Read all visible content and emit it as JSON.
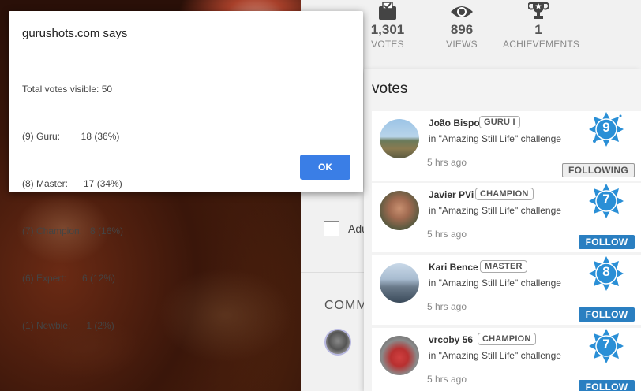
{
  "dialog": {
    "title": "gurushots.com says",
    "lines": [
      "Total votes visible: 50",
      "(9) Guru:        18 (36%)",
      "(8) Master:      17 (34%)",
      "(7) Champion:   8 (16%)",
      "(6) Expert:      6 (12%)",
      "(1) Newbie:      1 (2%)"
    ],
    "ok_label": "OK"
  },
  "stats": {
    "votes": {
      "value": "1,301",
      "label": "VOTES",
      "icon": "ballot-box-icon"
    },
    "views": {
      "value": "896",
      "label": "VIEWS",
      "icon": "eye-icon"
    },
    "achievements": {
      "value": "1",
      "label": "ACHIEVEMENTS",
      "icon": "trophy-icon"
    }
  },
  "page": {
    "adult_label": "Adu",
    "comments_title": "COMM"
  },
  "panel": {
    "title": "votes",
    "items": [
      {
        "name": "João Bispo",
        "rank": "GURU I",
        "challenge": "in \"Amazing Still Life\" challenge",
        "time": "5 hrs ago",
        "level": "9",
        "button": "FOLLOWING"
      },
      {
        "name": "Javier PVi",
        "rank": "CHAMPION",
        "challenge": "in \"Amazing Still Life\" challenge",
        "time": "5 hrs ago",
        "level": "7",
        "button": "FOLLOW"
      },
      {
        "name": "Kari Bence",
        "rank": "MASTER",
        "challenge": "in \"Amazing Still Life\" challenge",
        "time": "5 hrs ago",
        "level": "8",
        "button": "FOLLOW"
      },
      {
        "name": "vrcoby 56",
        "rank": "CHAMPION",
        "challenge": "in \"Amazing Still Life\" challenge",
        "time": "5 hrs ago",
        "level": "7",
        "button": "FOLLOW"
      }
    ]
  },
  "colors": {
    "follow_blue": "#2a7fc1",
    "star_blue": "#2a8fd6",
    "ok_blue": "#3a7ee6"
  }
}
